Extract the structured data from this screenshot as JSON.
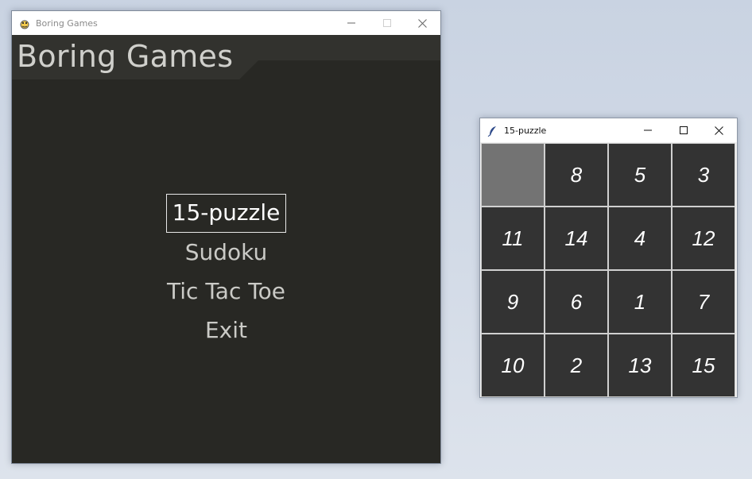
{
  "main_window": {
    "title": "Boring Games",
    "banner_title": "Boring Games",
    "menu": [
      {
        "label": "15-puzzle",
        "selected": true
      },
      {
        "label": "Sudoku",
        "selected": false
      },
      {
        "label": "Tic Tac Toe",
        "selected": false
      },
      {
        "label": "Exit",
        "selected": false
      }
    ]
  },
  "puzzle_window": {
    "title": "15-puzzle",
    "tiles": [
      "",
      "8",
      "5",
      "3",
      "11",
      "14",
      "4",
      "12",
      "9",
      "6",
      "1",
      "7",
      "10",
      "2",
      "13",
      "15"
    ]
  },
  "colors": {
    "game_background": "#282824",
    "banner": "#32322e",
    "tile": "#333333",
    "empty_tile": "#737373"
  }
}
